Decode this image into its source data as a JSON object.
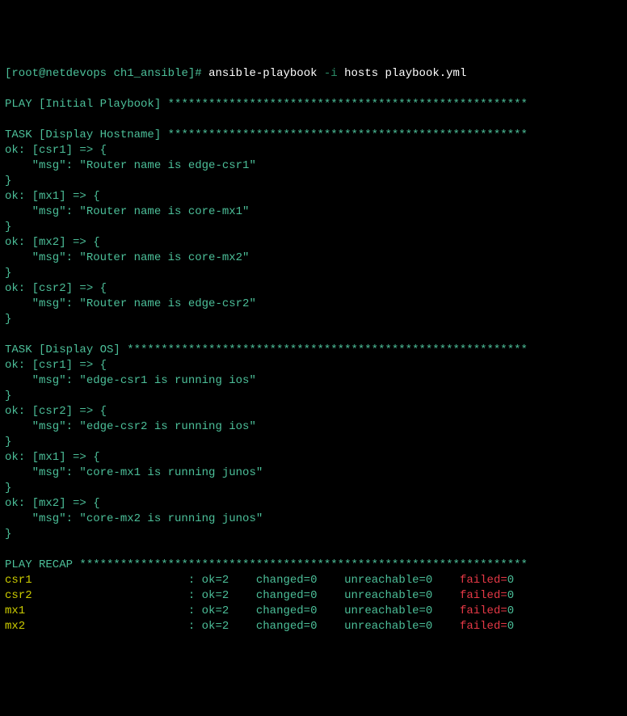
{
  "prompt": {
    "user_host": "root@netdevops",
    "dir": "ch1_ansible",
    "command": "ansible-playbook",
    "flag": "-i",
    "args": "hosts playbook.yml"
  },
  "play_header": "PLAY [Initial Playbook]",
  "task1_header": "TASK [Display Hostname]",
  "task2_header": "TASK [Display OS]",
  "task1_results": [
    {
      "host": "csr1",
      "msg": "Router name is edge-csr1"
    },
    {
      "host": "mx1",
      "msg": "Router name is core-mx1"
    },
    {
      "host": "mx2",
      "msg": "Router name is core-mx2"
    },
    {
      "host": "csr2",
      "msg": "Router name is edge-csr2"
    }
  ],
  "task2_results": [
    {
      "host": "csr1",
      "msg": "edge-csr1 is running ios"
    },
    {
      "host": "csr2",
      "msg": "edge-csr2 is running ios"
    },
    {
      "host": "mx1",
      "msg": "core-mx1 is running junos"
    },
    {
      "host": "mx2",
      "msg": "core-mx2 is running junos"
    }
  ],
  "recap_header": "PLAY RECAP",
  "recap": [
    {
      "host": "csr1",
      "ok": 2,
      "changed": 0,
      "unreachable": 0,
      "failed": 0
    },
    {
      "host": "csr2",
      "ok": 2,
      "changed": 0,
      "unreachable": 0,
      "failed": 0
    },
    {
      "host": "mx1",
      "ok": 2,
      "changed": 0,
      "unreachable": 0,
      "failed": 0
    },
    {
      "host": "mx2",
      "ok": 2,
      "changed": 0,
      "unreachable": 0,
      "failed": 0
    }
  ],
  "stars_play": " *****************************************************",
  "stars_task1": " *****************************************************",
  "stars_task2": " ***********************************************************",
  "stars_recap": " ******************************************************************",
  "literals": {
    "lbracket": "[",
    "rbracket": "]",
    "hash": "#",
    "ok_prefix": "ok: [",
    "arrow": "] => {",
    "msg_open": "    \"msg\": \"",
    "msg_close": "\"",
    "brace_close": "}",
    "colon": " : ",
    "ok_eq": "ok=",
    "changed_eq": "changed=",
    "unreachable_eq": "unreachable=",
    "failed_eq": "failed=",
    "space": " ",
    "gap4": "    ",
    "gap1": " "
  }
}
